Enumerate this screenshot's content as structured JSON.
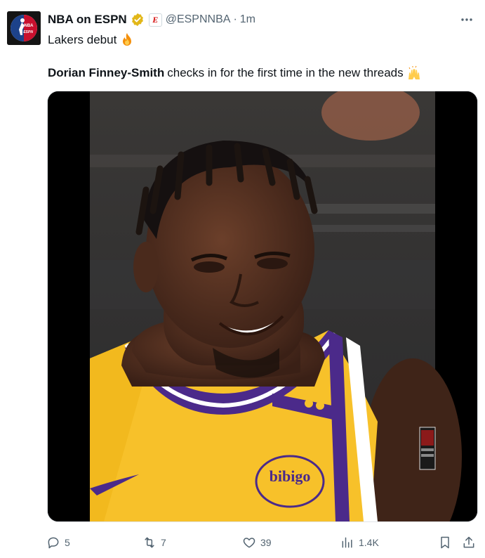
{
  "author": {
    "display_name": "NBA on ESPN",
    "handle": "@ESPNNBA",
    "separator": "·",
    "time": "1m",
    "avatar_text_top": "NBA",
    "avatar_text_bottom": "ESPN"
  },
  "tweet": {
    "line1": "Lakers debut",
    "player_name": "Dorian Finney-Smith",
    "line2_rest": "checks in for the first time in the new threads",
    "jersey_sponsor": "bibigo"
  },
  "actions": {
    "replies": "5",
    "reposts": "7",
    "likes": "39",
    "views": "1.4K"
  },
  "colors": {
    "text": "#0f1419",
    "secondary": "#536471",
    "verified_gold": "#e2b719",
    "espn_red": "#d50a0a",
    "jersey_gold": "#f7c12a",
    "jersey_purple": "#4b2a8a"
  },
  "icons": [
    "verified-icon",
    "espn-affiliate-icon",
    "more-icon",
    "fire-emoji",
    "raising-hands-emoji",
    "reply-icon",
    "repost-icon",
    "like-icon",
    "views-icon",
    "bookmark-icon",
    "share-icon"
  ]
}
